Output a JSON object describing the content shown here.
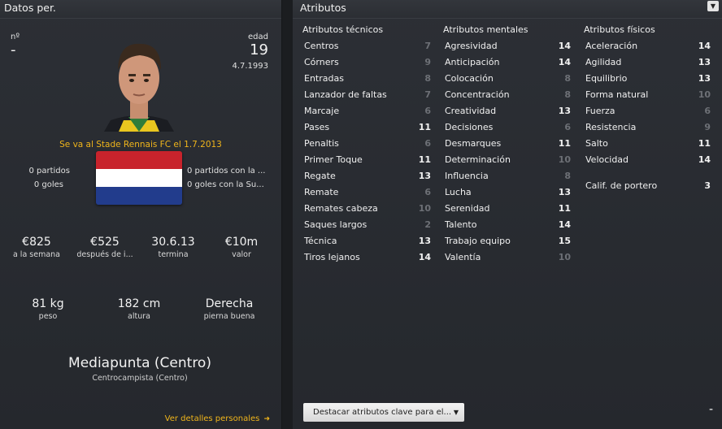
{
  "left": {
    "header": "Datos per.",
    "number_label": "nº",
    "number_value": "-",
    "age_label": "edad",
    "age_value": "19",
    "birth_date": "4.7.1993",
    "transfer_note": "Se va al Stade Rennais FC el 1.7.2013",
    "flag_colors": [
      "#c8232c",
      "#ffffff",
      "#223c8c"
    ],
    "left_stats": [
      "0 partidos",
      "0 goles"
    ],
    "right_stats": [
      "0 partidos con la ...",
      "0 goles con la Su..."
    ],
    "finance": [
      {
        "value": "€825",
        "label": "a la semana"
      },
      {
        "value": "€525",
        "label": "después de i..."
      },
      {
        "value": "30.6.13",
        "label": "termina"
      },
      {
        "value": "€10m",
        "label": "valor"
      }
    ],
    "physical": [
      {
        "value": "81 kg",
        "label": "peso"
      },
      {
        "value": "182 cm",
        "label": "altura"
      },
      {
        "value": "Derecha",
        "label": "pierna buena"
      }
    ],
    "position": "Mediapunta (Centro)",
    "position_sub": "Centrocampista (Centro)",
    "details_link": "Ver detalles personales"
  },
  "right": {
    "header": "Atributos",
    "technical_title": "Atributos técnicos",
    "mental_title": "Atributos mentales",
    "physical_title": "Atributos físicos",
    "technical": [
      {
        "name": "Centros",
        "value": 7
      },
      {
        "name": "Córners",
        "value": 9
      },
      {
        "name": "Entradas",
        "value": 8
      },
      {
        "name": "Lanzador de faltas",
        "value": 7
      },
      {
        "name": "Marcaje",
        "value": 6
      },
      {
        "name": "Pases",
        "value": 11
      },
      {
        "name": "Penaltis",
        "value": 6
      },
      {
        "name": "Primer Toque",
        "value": 11
      },
      {
        "name": "Regate",
        "value": 13
      },
      {
        "name": "Remate",
        "value": 6
      },
      {
        "name": "Remates cabeza",
        "value": 10
      },
      {
        "name": "Saques largos",
        "value": 2
      },
      {
        "name": "Técnica",
        "value": 13
      },
      {
        "name": "Tiros lejanos",
        "value": 14
      }
    ],
    "mental": [
      {
        "name": "Agresividad",
        "value": 14
      },
      {
        "name": "Anticipación",
        "value": 14
      },
      {
        "name": "Colocación",
        "value": 8
      },
      {
        "name": "Concentración",
        "value": 8
      },
      {
        "name": "Creatividad",
        "value": 13
      },
      {
        "name": "Decisiones",
        "value": 6
      },
      {
        "name": "Desmarques",
        "value": 11
      },
      {
        "name": "Determinación",
        "value": 10
      },
      {
        "name": "Influencia",
        "value": 8
      },
      {
        "name": "Lucha",
        "value": 13
      },
      {
        "name": "Serenidad",
        "value": 11
      },
      {
        "name": "Talento",
        "value": 14
      },
      {
        "name": "Trabajo equipo",
        "value": 15
      },
      {
        "name": "Valentía",
        "value": 10
      }
    ],
    "physical": [
      {
        "name": "Aceleración",
        "value": 14
      },
      {
        "name": "Agilidad",
        "value": 13
      },
      {
        "name": "Equilibrio",
        "value": 13
      },
      {
        "name": "Forma natural",
        "value": 10
      },
      {
        "name": "Fuerza",
        "value": 6
      },
      {
        "name": "Resistencia",
        "value": 9
      },
      {
        "name": "Salto",
        "value": 11
      },
      {
        "name": "Velocidad",
        "value": 14
      }
    ],
    "goalkeeper_label": "Calif. de portero",
    "goalkeeper_value": 3,
    "highlight_dropdown": "Destacar atributos clave para el...",
    "minus_label": "-"
  }
}
